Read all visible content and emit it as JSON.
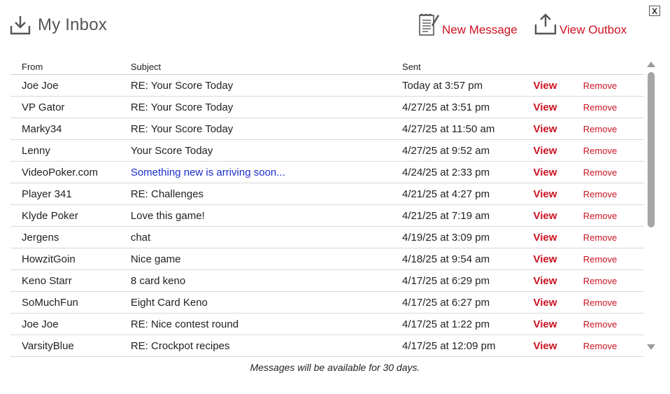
{
  "close_label": "X",
  "header": {
    "title": "My Inbox"
  },
  "actions": {
    "new_message": "New Message",
    "view_outbox": "View Outbox"
  },
  "columns": {
    "from": "From",
    "subject": "Subject",
    "sent": "Sent"
  },
  "messages": [
    {
      "from": "Joe Joe",
      "subject": "RE: Your Score Today",
      "sent": "Today at 3:57 pm",
      "view": "View",
      "remove": "Remove"
    },
    {
      "from": "VP Gator",
      "subject": "RE: Your Score Today",
      "sent": "4/27/25 at 3:51 pm",
      "view": "View",
      "remove": "Remove"
    },
    {
      "from": "Marky34",
      "subject": "RE: Your Score Today",
      "sent": "4/27/25 at 11:50 am",
      "view": "View",
      "remove": "Remove"
    },
    {
      "from": "Lenny",
      "subject": "Your Score Today",
      "sent": "4/27/25 at 9:52 am",
      "view": "View",
      "remove": "Remove"
    },
    {
      "from": "VideoPoker.com",
      "subject": "Something new is arriving soon...",
      "sent": "4/24/25 at 2:33 pm",
      "view": "View",
      "remove": "Remove"
    },
    {
      "from": "Player 341",
      "subject": "RE: Challenges",
      "sent": "4/21/25 at 4:27 pm",
      "view": "View",
      "remove": "Remove"
    },
    {
      "from": "Klyde Poker",
      "subject": "Love this game!",
      "sent": "4/21/25 at 7:19 am",
      "view": "View",
      "remove": "Remove"
    },
    {
      "from": "Jergens",
      "subject": "chat",
      "sent": "4/19/25 at 3:09 pm",
      "view": "View",
      "remove": "Remove"
    },
    {
      "from": "HowzitGoin",
      "subject": "Nice game",
      "sent": "4/18/25 at 9:54 am",
      "view": "View",
      "remove": "Remove"
    },
    {
      "from": "Keno Starr",
      "subject": "8 card keno",
      "sent": "4/17/25 at 6:29 pm",
      "view": "View",
      "remove": "Remove"
    },
    {
      "from": "SoMuchFun",
      "subject": "Eight Card Keno",
      "sent": "4/17/25 at 6:27 pm",
      "view": "View",
      "remove": "Remove"
    },
    {
      "from": "Joe Joe",
      "subject": "RE: Nice contest round",
      "sent": "4/17/25 at 1:22 pm",
      "view": "View",
      "remove": "Remove"
    },
    {
      "from": "VarsityBlue",
      "subject": "RE: Crockpot recipes",
      "sent": "4/17/25 at 12:09 pm",
      "view": "View",
      "remove": "Remove"
    }
  ],
  "footer_note": "Messages will be available for 30 days.",
  "colors": {
    "accent": "#cc1122",
    "link_blue": "#1a2ecc",
    "title_gray": "#555555"
  },
  "icons": {
    "header": "inbox-download-icon",
    "new_message": "notepad-icon",
    "view_outbox": "upload-icon"
  }
}
